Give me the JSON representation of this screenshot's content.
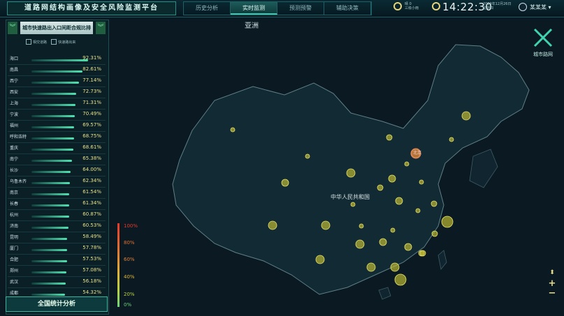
{
  "header": {
    "title": "道路网结构画像及安全风险监测平台",
    "tabs": [
      "历史分析",
      "实时监测",
      "预测预警",
      "辅助决策"
    ],
    "active_tab": "实时监测",
    "weather_line1": "晴 0",
    "weather_line2": "三级小雨",
    "time": "14:22:30",
    "date_line1": "2019年12月26日",
    "date_line2": "星期四",
    "user_name": "某某某"
  },
  "ranking": {
    "title": "城市快速路出入口间距合规比排名",
    "checkbox_1": "相交道路",
    "checkbox_2": "快速路出来",
    "items": [
      {
        "city": "海口",
        "pct": "92.31%",
        "ratio": 0.9231
      },
      {
        "city": "南昌",
        "pct": "82.61%",
        "ratio": 0.8261
      },
      {
        "city": "西宁",
        "pct": "77.14%",
        "ratio": 0.7714
      },
      {
        "city": "西安",
        "pct": "72.73%",
        "ratio": 0.7273
      },
      {
        "city": "上海",
        "pct": "71.31%",
        "ratio": 0.7131
      },
      {
        "city": "宁波",
        "pct": "70.49%",
        "ratio": 0.7049
      },
      {
        "city": "福州",
        "pct": "69.57%",
        "ratio": 0.6957
      },
      {
        "city": "呼和浩特",
        "pct": "68.75%",
        "ratio": 0.6875
      },
      {
        "city": "重庆",
        "pct": "68.61%",
        "ratio": 0.6861
      },
      {
        "city": "南宁",
        "pct": "65.38%",
        "ratio": 0.6538
      },
      {
        "city": "长沙",
        "pct": "64.00%",
        "ratio": 0.64
      },
      {
        "city": "乌鲁木齐",
        "pct": "62.34%",
        "ratio": 0.6234
      },
      {
        "city": "南京",
        "pct": "61.54%",
        "ratio": 0.6154
      },
      {
        "city": "长春",
        "pct": "61.34%",
        "ratio": 0.6134
      },
      {
        "city": "杭州",
        "pct": "60.87%",
        "ratio": 0.6087
      },
      {
        "city": "济南",
        "pct": "60.53%",
        "ratio": 0.6053
      },
      {
        "city": "昆明",
        "pct": "58.49%",
        "ratio": 0.5849
      },
      {
        "city": "厦门",
        "pct": "57.78%",
        "ratio": 0.5778
      },
      {
        "city": "合肥",
        "pct": "57.53%",
        "ratio": 0.5753
      },
      {
        "city": "郑州",
        "pct": "57.08%",
        "ratio": 0.5708
      },
      {
        "city": "武汉",
        "pct": "56.18%",
        "ratio": 0.5618
      },
      {
        "city": "成都",
        "pct": "54.32%",
        "ratio": 0.5432
      }
    ],
    "stat_button": "全国统计分析"
  },
  "map": {
    "region_label": "亚洲",
    "country_label": "中华人民共和国",
    "beijing_label": "北京",
    "logo_label": "城市路网",
    "legend": [
      "100%",
      "80%",
      "60%",
      "40%",
      "20%",
      "0%"
    ],
    "legend_colors": [
      "#e8372a",
      "#e36f2f",
      "#e07f35",
      "#e0b435",
      "#b7d23e",
      "#6bd37b"
    ]
  }
}
